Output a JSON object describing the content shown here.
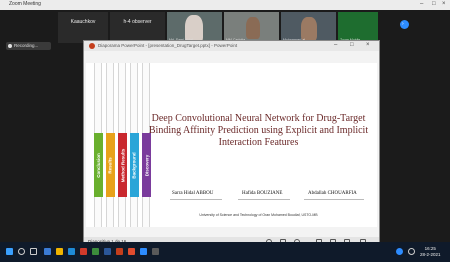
{
  "zoom": {
    "window_title": "Zoom Meeting",
    "recording_label": "Recording...",
    "participants": [
      {
        "name": "Kaauchkov",
        "kind": "text"
      },
      {
        "name": "h-4 observer",
        "kind": "text"
      },
      {
        "name": "Md. Sami Hidal",
        "kind": "video"
      },
      {
        "name": "MM-Carlotta",
        "kind": "video"
      },
      {
        "name": "Mohammed al...",
        "kind": "video"
      },
      {
        "name": "Zoom Mobile",
        "kind": "video"
      }
    ]
  },
  "ppt": {
    "window_title": "Diaporama PowerPoint - [presentation_DrugTarget.pptx] - PowerPoint",
    "status_slide": "Diapositive 1 de 16",
    "slide": {
      "title": "Deep Convolutional Neural Network for Drug-Target Binding Affinity Prediction using Explicit and Implicit Interaction Features",
      "authors": [
        "Sarra Hidal ABBOU",
        "Hafida BOUZIANE",
        "Abdallah CHOUARFIA"
      ],
      "affiliation": "University of Science and Technology of Oran Mohamed Boudiaf, USTO-MB",
      "sections": [
        {
          "label": "Conclusion",
          "color": "#6ab02e"
        },
        {
          "label": "Results",
          "color": "#e8a21a"
        },
        {
          "label": "Method Results",
          "color": "#c9282e"
        },
        {
          "label": "Background",
          "color": "#2aa5d8"
        },
        {
          "label": "Discovery",
          "color": "#7a3b9c"
        }
      ]
    }
  },
  "taskbar": {
    "time": "16:25",
    "date": "28-2-2021"
  }
}
